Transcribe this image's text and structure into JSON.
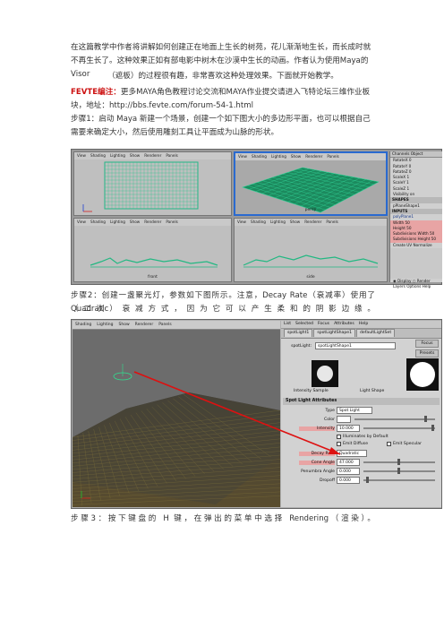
{
  "text": {
    "p1": "在这篇教学中作者将讲解如何创建正在地面上生长的树苑，花儿渐渐地生长，而长成时就不再生长了。这种效果正如有部电影中树木在沙漠中生长的动画。作者认为使用Maya的Visor",
    "p2": "（遮板）的过程很有趣，非常喜欢这种处理效果。下面就开始教学。",
    "p3_red": "FEVTE编注：",
    "p3_rest": "更多MAYA角色教程讨论交流和MAYA作业提交请进入飞特论坛三维作业板块，地址：http://bbs.fevte.com/forum-54-1.html",
    "p4": "步骤1：启动 Maya 新建一个场景，创建一个如下图大小的多边形平面，也可以根据自己需要来确定大小，然后使用雕刻工具让平面成为山脉的形状。",
    "p5": "步骤2：创建一盏聚光灯，参数如下图所示。注意，Decay Rate（衰减率）使用了 Quadratic",
    "p5b": "（二次）衰减方式，因为它可以产生柔和的阴影边缘。",
    "p6": "步骤3：按下键盘的 H 键，在弹出的菜单中选择 Rendering（渲染）。"
  },
  "fig1": {
    "menu": [
      "View",
      "Shading",
      "Lighting",
      "Show",
      "Renderer",
      "Panels"
    ],
    "labels": {
      "persp": "persp",
      "front": "front",
      "side": "side"
    },
    "channel_tabs": [
      "Channels",
      "Object"
    ],
    "channel_rows": [
      "RotateX 0",
      "RotateY 0",
      "RotateZ 0",
      "ScaleX 1",
      "ScaleY 1",
      "ScaleZ 1",
      "Visibility on"
    ],
    "shapes_header": "SHAPES",
    "shape_name": "pPlaneShape1",
    "inputs_header": "INPUTS",
    "input_name": "polyPlane1",
    "input_rows": [
      "Width 50",
      "Height 50",
      "Subdivisions Width 50",
      "Subdivisions Height 50",
      "Create UV Normalize"
    ],
    "layer_opts": [
      "Display",
      "Render"
    ],
    "layer_menu": [
      "Layers",
      "Options",
      "Help"
    ]
  },
  "fig2": {
    "menu": [
      "Shading",
      "Lighting",
      "Show",
      "Renderer",
      "Panels"
    ],
    "ae_menu": [
      "List",
      "Selected",
      "Focus",
      "Attributes",
      "Help"
    ],
    "ae_tabs": [
      "spotLight1",
      "spotLightShape1",
      "defaultLightSet"
    ],
    "node_type": "spotLight:",
    "node_name": "spotLightShape1",
    "focus_btn": "Focus",
    "presets_btn": "Presets",
    "intensity_sample": "Intensity Sample",
    "light_shape": "Light Shape",
    "section": "Spot Light Attributes",
    "type_label": "Type",
    "type_value": "Spot Light",
    "color_label": "Color",
    "intensity_label": "Intensity",
    "intensity_value": "10.000",
    "illum_default": "Illuminates by Default",
    "emit_diffuse": "Emit Diffuse",
    "emit_specular": "Emit Specular",
    "decay_label": "Decay Rate",
    "decay_value": "Quadratic",
    "cone_label": "Cone Angle",
    "cone_value": "47.000",
    "penumbra_label": "Penumbra Angle",
    "penumbra_value": "0.000",
    "dropoff_label": "Dropoff",
    "dropoff_value": "0.000"
  },
  "colors": {
    "highlight": "#e8a4a4",
    "red_text": "#cc1111",
    "arrow": "#dd1111",
    "mesh": "#22c08a"
  }
}
